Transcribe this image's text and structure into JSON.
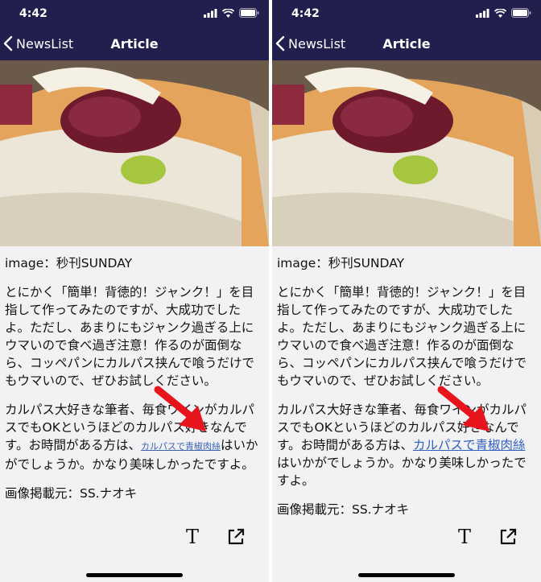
{
  "status": {
    "time": "4:42"
  },
  "nav": {
    "back_label": "NewsList",
    "title": "Article"
  },
  "article": {
    "image_credit": "image：秒刊SUNDAY",
    "paragraph1": "とにかく「簡単！背徳的！ジャンク！」を目指して作ってみたのですが、大成功でしたよ。ただし、あまりにもジャンク過ぎる上にウマいので食べ過ぎ注意！作るのが面倒なら、コッペパンにカルパス挟んで喰うだけでもウマいので、ぜひお試しください。",
    "paragraph2_prefix": "カルパス大好きな筆者、毎食ワインがカルパスでもOKというほどのカルパス好きなんです。お時間がある方は、",
    "link_text": "カルパスで青椒肉絲",
    "paragraph2_suffix": "はいかがでしょうか。かなり美味しかったですよ。",
    "source": "画像掲載元：SS.ナオキ"
  },
  "toolbar": {
    "text_size_glyph": "T"
  },
  "colors": {
    "nav_bar": "#221f4f",
    "arrow": "#e8141c",
    "link": "#2f5fc4"
  },
  "icons": [
    "signal-icon",
    "wifi-icon",
    "battery-icon",
    "back-chevron-icon",
    "text-size-icon",
    "share-icon"
  ]
}
